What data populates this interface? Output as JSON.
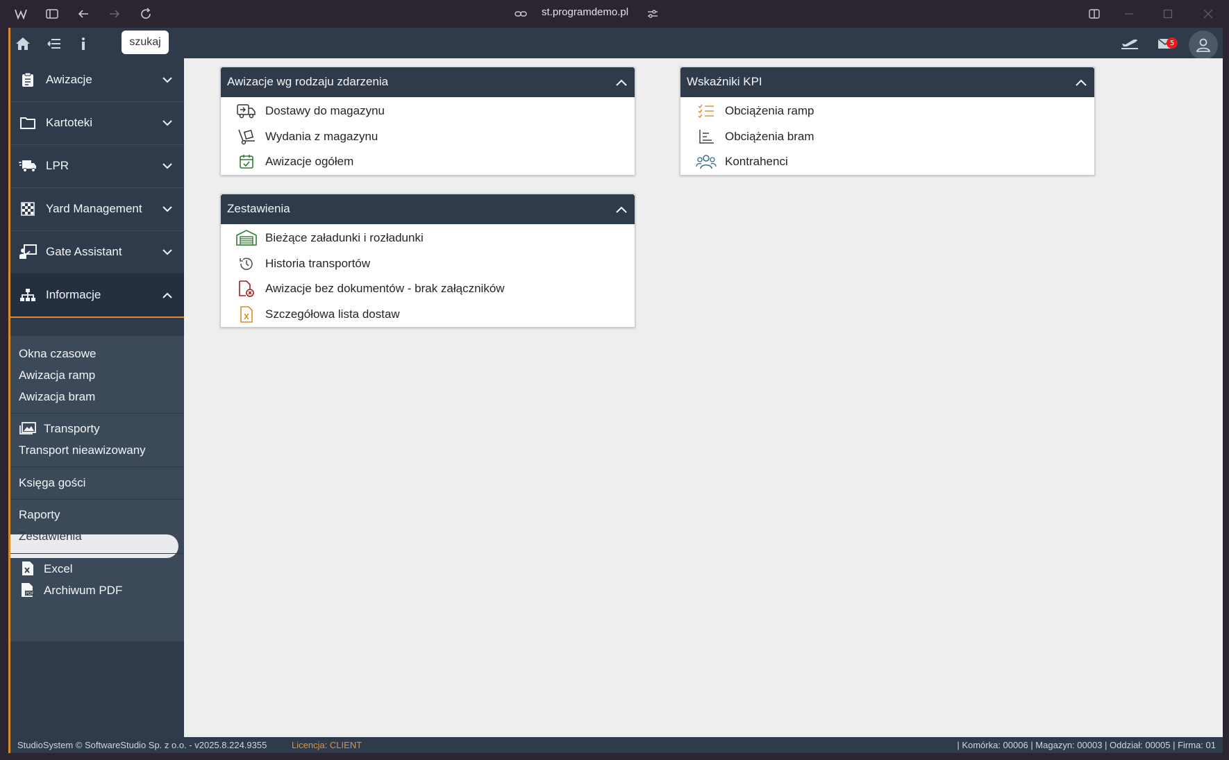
{
  "browser": {
    "url": "st.programdemo.pl"
  },
  "topbar": {
    "search_label": "szukaj",
    "mail_count": "5"
  },
  "sidebar": {
    "items": [
      {
        "label": "Awizacje"
      },
      {
        "label": "Kartoteki"
      },
      {
        "label": "LPR"
      },
      {
        "label": "Yard Management"
      },
      {
        "label": "Gate Assistant"
      },
      {
        "label": "Informacje"
      }
    ],
    "submenu": {
      "okna": "Okna czasowe",
      "ramp": "Awizacja ramp",
      "bram": "Awizacja bram",
      "transporty": "Transporty",
      "transport_nieawizowany": "Transport nieawizowany",
      "ksiega": "Księga gości",
      "raporty": "Raporty",
      "zestawienia": "Zestawienia",
      "excel": "Excel",
      "archiwum": "Archiwum PDF"
    }
  },
  "panels": {
    "awizacje": {
      "title": "Awizacje wg rodzaju zdarzenia",
      "rows": [
        {
          "label": "Dostawy do magazynu"
        },
        {
          "label": "Wydania z magazynu"
        },
        {
          "label": "Awizacje ogółem"
        }
      ]
    },
    "zestawienia": {
      "title": "Zestawienia",
      "rows": [
        {
          "label": "Bieżące załadunki i rozładunki"
        },
        {
          "label": "Historia transportów"
        },
        {
          "label": "Awizacje bez dokumentów - brak załączników"
        },
        {
          "label": "Szczegółowa lista dostaw"
        }
      ]
    },
    "kpi": {
      "title": "Wskaźniki KPI",
      "rows": [
        {
          "label": "Obciążenia ramp"
        },
        {
          "label": "Obciążenia bram"
        },
        {
          "label": "Kontrahenci"
        }
      ]
    }
  },
  "footer": {
    "copyright": "StudioSystem © SoftwareStudio Sp. z o.o. - v2025.8.224.9355",
    "license": "Licencja: CLIENT",
    "info": "| Komórka: 00006 | Magazyn: 00003 | Oddział: 00005 | Firma: 01"
  },
  "colors": {
    "accent": "#d58d2e",
    "navy": "#2f3b4a",
    "badge": "#e41c1c"
  }
}
